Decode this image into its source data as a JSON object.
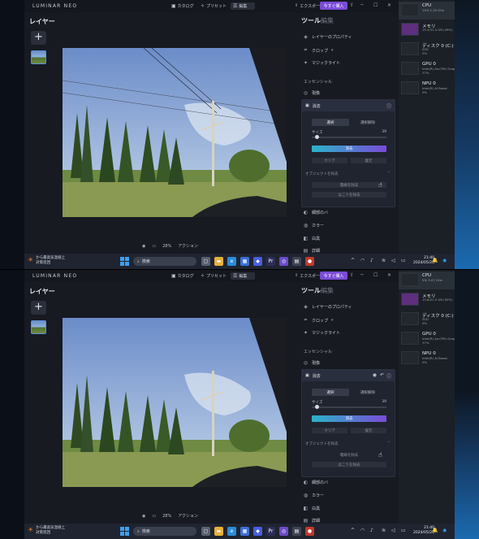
{
  "app": {
    "logo": "LUMINAR NEO",
    "menu": [
      {
        "label": "カタログ",
        "icon": "catalog-icon"
      },
      {
        "label": "プリセット",
        "icon": "preset-icon"
      },
      {
        "label": "編集",
        "icon": "edit-icon"
      }
    ],
    "export_label": "エクスポート",
    "buy_label": "今すぐ購入",
    "layers_title": "レイヤー",
    "tools_title": "ツール",
    "edit_tab": "編集",
    "canvas_toolbar": {
      "zoom": "28%",
      "actions": "アクション"
    }
  },
  "tools": {
    "top_items": [
      "レイヤーのプロパティ",
      "クロップ",
      "マジックライト"
    ],
    "section": "エッセンシャル",
    "items_above": [
      "現像"
    ],
    "erase": {
      "title": "消去",
      "seg_on": "選択",
      "seg_off": "選択解除",
      "size_label": "サイズ",
      "size_value": "39",
      "erase_button": "消去",
      "clear_button": "クリア",
      "reset_button": "復元",
      "objects_title": "オブジェクトを除去",
      "obj_btn1": "電線を除去",
      "obj_btn2": "ほこりを除去"
    },
    "items_below": [
      "細部のバ",
      "カラー",
      "白黒",
      "詳細"
    ]
  },
  "taskbar": {
    "weather_line1": "から最高気温値上",
    "weather_line2": "対策巡回",
    "search_placeholder": "検索",
    "time": "21:40",
    "date": "2024/05/25"
  },
  "perf_top": [
    {
      "name": "CPU",
      "sub": "14% 1.20 GHz"
    },
    {
      "name": "メモリ",
      "sub": "15.3/31.5 GB (49%)"
    },
    {
      "name": "ディスク 0 (C:)",
      "sub": "SSD\n0%"
    },
    {
      "name": "GPU 0",
      "sub": "Intel(R) Arc(TM) Grap\n37%"
    },
    {
      "name": "NPU 0",
      "sub": "Intel(R) AI Boost\n0%"
    }
  ],
  "perf_bottom": [
    {
      "name": "CPU",
      "sub": "5% 3.07 GHz"
    },
    {
      "name": "メモリ",
      "sub": "15.8/31.5 GB (50%)"
    },
    {
      "name": "ディスク 0 (C:)",
      "sub": "SSD\n0%"
    },
    {
      "name": "GPU 0",
      "sub": "Intel(R) Arc(TM) Grap\n37%"
    },
    {
      "name": "NPU 0",
      "sub": "Intel(R) AI Boost\n0%"
    }
  ]
}
